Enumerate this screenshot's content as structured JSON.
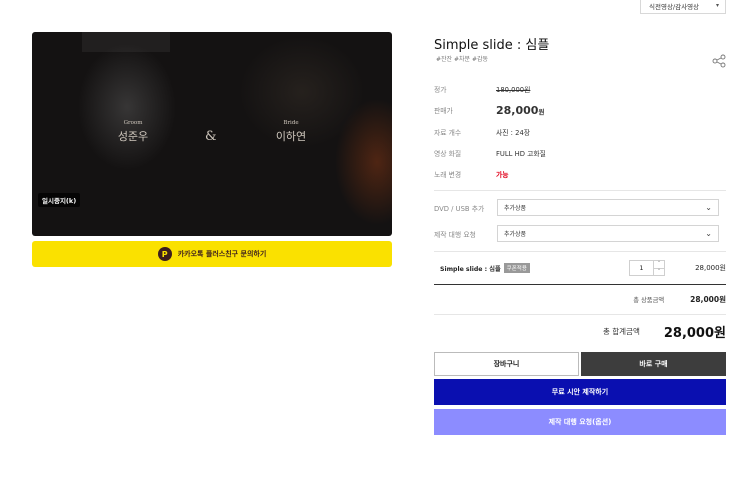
{
  "top_dropdown": {
    "value": "식전영상/감사영상"
  },
  "video": {
    "groom_role": "Groom",
    "groom_name": "성준우",
    "ampersand": "&",
    "bride_role": "Bride",
    "bride_name": "이하연",
    "pause_label": "일시중지(k)"
  },
  "kakao": {
    "icon": "kakao-plus-friend-icon",
    "label": "카카오톡 플러스친구 문의하기",
    "color": "#fae100"
  },
  "product": {
    "title": "Simple slide : 심플",
    "tags": "#잔잔 #차분 #감동",
    "rows": [
      {
        "label": "정가",
        "value": "180,000원"
      },
      {
        "label": "판매가",
        "value": "28,000",
        "unit": "원"
      },
      {
        "label": "자료 개수",
        "value": "사진 : 24장"
      },
      {
        "label": "영상 화질",
        "value": "FULL HD 고화질"
      },
      {
        "label": "노래 변경",
        "value": "가능"
      }
    ]
  },
  "options": [
    {
      "label": "DVD / USB 추가",
      "placeholder": "추가상품"
    },
    {
      "label": "제작 대행 요청",
      "placeholder": "추가상품"
    }
  ],
  "selected_item": {
    "name": "Simple slide : 심플",
    "badge": "쿠폰적용",
    "quantity": "1",
    "price": "28,000원"
  },
  "summary": {
    "subtotal_label": "총 상품금액",
    "subtotal_value": "28,000원",
    "total_label": "총 합계금액",
    "total_value": "28,000원"
  },
  "buttons": {
    "cart": "장바구니",
    "buy": "바로 구매",
    "free_trial": "무료 시안 제작하기",
    "agent_request": "제작 대행 요청(옵션)"
  },
  "colors": {
    "sale_red": "#e0001a",
    "buy_dark": "#3d3d3d",
    "free_trial_blue": "#0a0fb0",
    "agent_purple": "#8c8cff"
  }
}
